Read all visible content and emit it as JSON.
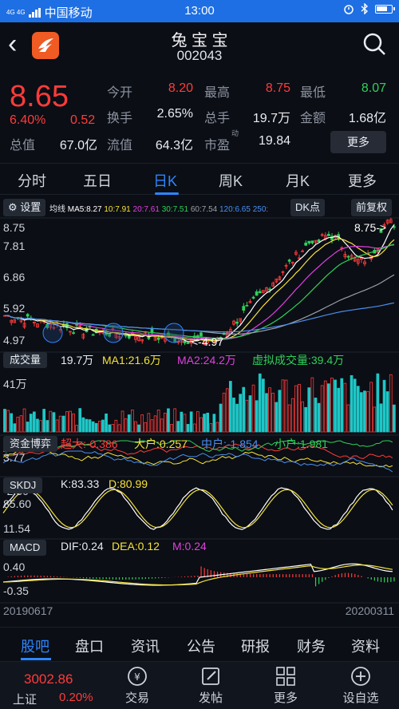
{
  "status_bar": {
    "network": "4G 4G",
    "carrier": "中国移动",
    "time": "13:00"
  },
  "header": {
    "stock_name": "兔 宝 宝",
    "stock_code": "002043"
  },
  "quote": {
    "price": "8.65",
    "change_pct": "6.40%",
    "change": "0.52",
    "open_label": "今开",
    "open": "8.20",
    "high_label": "最高",
    "high": "8.75",
    "low_label": "最低",
    "low": "8.07",
    "turnover_label": "换手",
    "turnover": "2.65%",
    "volume_label": "总手",
    "volume": "19.7万",
    "amount_label": "金额",
    "amount": "1.68亿",
    "mktcap_label": "总值",
    "mktcap": "67.0亿",
    "float_label": "流值",
    "float": "64.3亿",
    "pe_label": "市盈",
    "pe_sup": "动",
    "pe": "19.84",
    "more_label": "更多"
  },
  "period_tabs": [
    "分时",
    "五日",
    "日K",
    "周K",
    "月K",
    "更多"
  ],
  "toolbar": {
    "settings_label": "设置",
    "ma_title": "均线",
    "ma5": "MA5:8.27",
    "ma10": "10:7.91",
    "ma20": "20:7.61",
    "ma30": "30:7.51",
    "ma60": "60:7.54",
    "ma120": "120:6.65",
    "ma250": "250:",
    "dk_label": "DK点",
    "adjust_label": "前复权"
  },
  "price_axis": [
    "8.75",
    "7.81",
    "6.86",
    "5.92",
    "4.97"
  ],
  "price_annotations": {
    "high_mark": "8.75->",
    "low_mark": "<-4.97"
  },
  "volume_panel": {
    "label": "成交量",
    "vol": "19.7万",
    "ma1": "MA1:21.6万",
    "ma2": "MA2:24.2万",
    "virtual": "虚拟成交量:39.4万",
    "axis_top": "41万"
  },
  "fund_panel": {
    "label": "资金博弈",
    "super": "超大:-0.386",
    "large": "大户:0.257",
    "mid": "中户:-1.854",
    "small": "小户:1.981",
    "axis_top": "3.77",
    "axis_bottom": "-2.50"
  },
  "skdj_panel": {
    "label": "SKDJ",
    "k": "K:83.33",
    "d": "D:80.99",
    "axis_top": "85.60",
    "axis_bottom": "11.54"
  },
  "macd_panel": {
    "label": "MACD",
    "dif": "DIF:0.24",
    "dea": "DEA:0.12",
    "m": "M:0.24",
    "axis_top": "0.40",
    "axis_bottom": "-0.35"
  },
  "date_axis": {
    "start": "20190617",
    "end": "20200311"
  },
  "bottom_tabs": [
    "股吧",
    "盘口",
    "资讯",
    "公告",
    "研报",
    "财务",
    "资料"
  ],
  "footer": {
    "index_value": "3002.86",
    "index_name": "上证",
    "index_pct": "0.20%",
    "items": [
      "交易",
      "发帖",
      "更多",
      "设自选"
    ]
  },
  "colors": {
    "up": "#ff3b3b",
    "down": "#2fd15a",
    "accent": "#2d86ff",
    "ma5": "#ffffff",
    "ma10": "#f5e23a",
    "ma20": "#e040e0",
    "ma30": "#2fd15a",
    "ma60": "#9aa0a8",
    "ma120": "#4a8ff0"
  }
}
